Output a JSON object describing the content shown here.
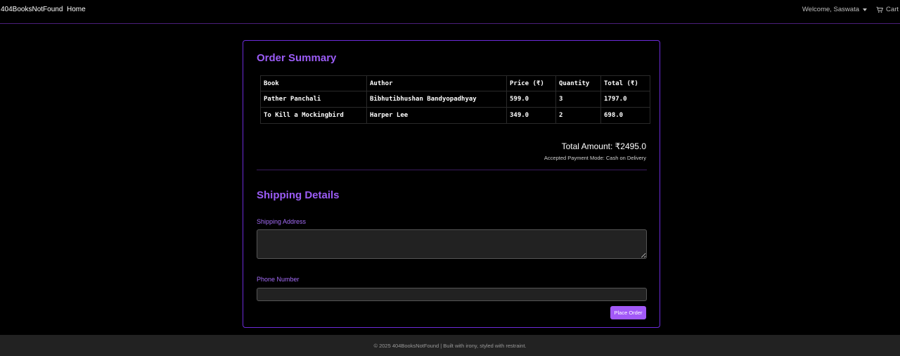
{
  "navbar": {
    "brand": "404BooksNotFound",
    "home": "Home",
    "welcome": "Welcome, Saswata",
    "cart": "Cart",
    "cart_icon": "cart-icon",
    "dropdown_icon": "caret-down-icon"
  },
  "order": {
    "title": "Order Summary",
    "headers": {
      "book": "Book",
      "author": "Author",
      "price": "Price (₹)",
      "qty": "Quantity",
      "total": "Total (₹)"
    },
    "rows": [
      {
        "book": "Pather Panchali",
        "author": "Bibhutibhushan Bandyopadhyay",
        "price": "599.0",
        "qty": "3",
        "total": "1797.0"
      },
      {
        "book": "To Kill a Mockingbird",
        "author": "Harper Lee",
        "price": "349.0",
        "qty": "2",
        "total": "698.0"
      }
    ],
    "total_amount": "Total Amount: ₹2495.0",
    "payment_mode": "Accepted Payment Mode: Cash on Delivery"
  },
  "shipping": {
    "title": "Shipping Details",
    "address_label": "Shipping Address",
    "address_value": "",
    "phone_label": "Phone Number",
    "phone_value": "",
    "place_order": "Place Order"
  },
  "footer": {
    "text": "© 2025 404BooksNotFound  |  Built with irony, styled with restraint."
  },
  "colors": {
    "accent": "#9b5cf6",
    "button": "#a259f7",
    "background": "#000000",
    "footer_bg": "#222222"
  }
}
